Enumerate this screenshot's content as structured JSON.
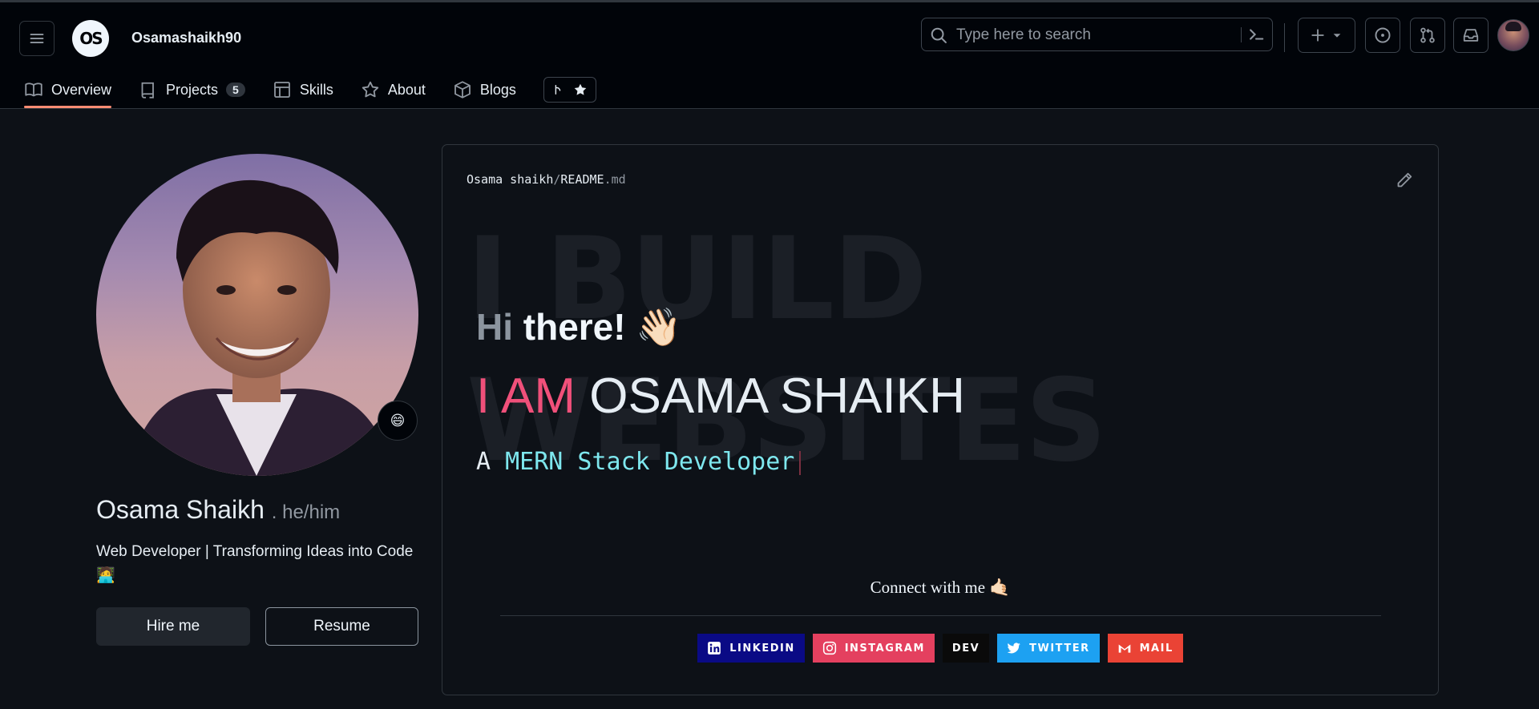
{
  "header": {
    "logo_text": "OS",
    "username": "Osamashaikh90",
    "search_placeholder": "Type here to search"
  },
  "tabs": [
    {
      "label": "Overview",
      "active": true
    },
    {
      "label": "Projects",
      "count": "5"
    },
    {
      "label": "Skills"
    },
    {
      "label": "About"
    },
    {
      "label": "Blogs"
    }
  ],
  "profile": {
    "name": "Osama Shaikh",
    "pronouns": ". he/him",
    "status_emoji": "😄",
    "bio": "Web Developer | Transforming Ideas into Code🧑‍💻",
    "hire_label": "Hire me",
    "resume_label": "Resume"
  },
  "readme": {
    "path_owner": "Osama shaikh",
    "path_slash": "/",
    "path_file": "README",
    "path_ext": ".md",
    "bg_line1": "I BUILD",
    "bg_line2": "WEBSITES",
    "hi_dim": "Hi",
    "hi_rest": " there! 👋🏻",
    "iam": "I AM",
    "fullname": "OSAMA SHAIKH",
    "role_prefix": "A",
    "role": "MERN Stack Developer",
    "connect": "Connect with me 🤙🏻"
  },
  "socials": [
    {
      "label": "LINKEDIN",
      "color": "#0a0a85"
    },
    {
      "label": "INSTAGRAM",
      "color": "#e4405f"
    },
    {
      "label": "DEV",
      "color": "#0a0a0a"
    },
    {
      "label": "TWITTER",
      "color": "#1da1f2"
    },
    {
      "label": "MAIL",
      "color": "#ea4335"
    }
  ],
  "colors": {
    "accent_underline": "#fd8c73",
    "name_pink": "#f0507a",
    "role_cyan": "#7ee7ee"
  }
}
